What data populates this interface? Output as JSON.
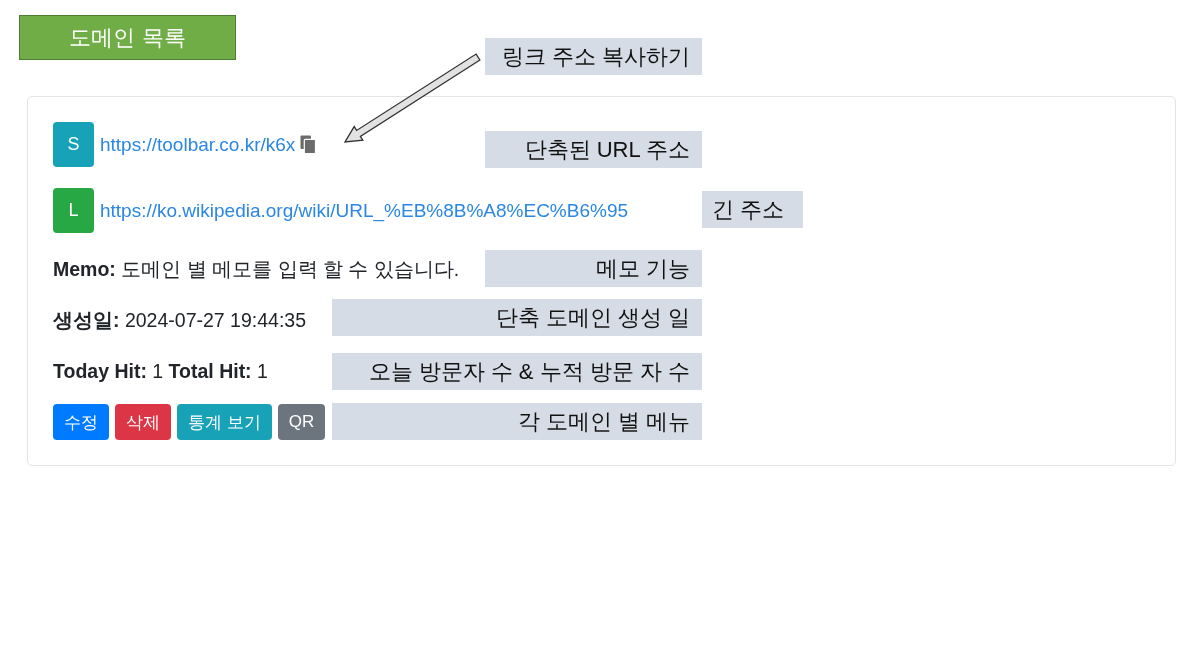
{
  "title_banner": "도메인 목록",
  "domain_card": {
    "links": [
      {
        "badge": "S",
        "color": "#17a2b8",
        "url": "https://toolbar.co.kr/k6x",
        "copy_icon": true
      },
      {
        "badge": "L",
        "color": "#28a745",
        "url": "https://ko.wikipedia.org/wiki/URL_%EB%8B%A8%EC%B6%95",
        "copy_icon": false
      }
    ],
    "memo": "**Memo:** 도메인 별 메모를 입력 할 수 있습니다.",
    "created": "**생성일:** 2024-07-27 19:44:35",
    "hits": "**Today Hit:** 1 **Total Hit:** 1",
    "buttons": [
      {
        "label": "수정",
        "color": "#007bff"
      },
      {
        "label": "삭제",
        "color": "#dc3545"
      },
      {
        "label": "통계 보기",
        "color": "#17a2b8"
      },
      {
        "label": "QR",
        "color": "#6c757d"
      }
    ]
  },
  "annotations": [
    "링크 주소 복사하기",
    "단축된 URL 주소",
    "긴 주소",
    "메모 기능",
    "단축 도메인 생성 일",
    "오늘 방문자 수 & 누적 방문 자 수",
    "각 도메인 별 메뉴"
  ]
}
